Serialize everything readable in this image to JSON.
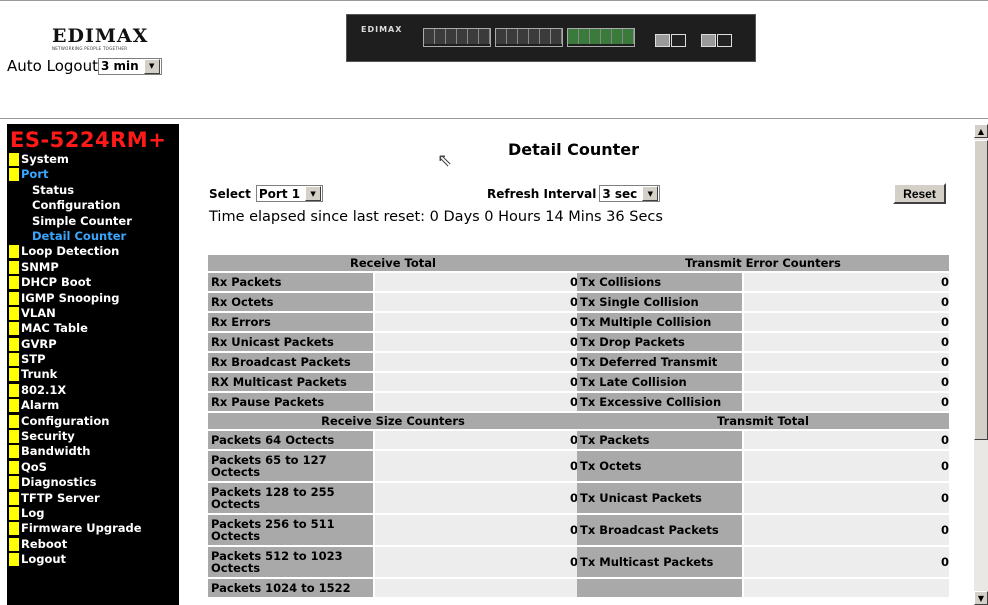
{
  "brand": {
    "logo": "EDIMAX",
    "tagline": "NETWORKING PEOPLE TOGETHER",
    "switch_label": "EDIMAX"
  },
  "auto_logout": {
    "label": "Auto Logout",
    "value": "3 min"
  },
  "product_name": "ES-5224RM+",
  "nav": [
    {
      "label": "System",
      "active": false,
      "sub": false
    },
    {
      "label": "Port",
      "active": true,
      "sub": false
    },
    {
      "label": "Status",
      "active": false,
      "sub": true
    },
    {
      "label": "Configuration",
      "active": false,
      "sub": true
    },
    {
      "label": "Simple Counter",
      "active": false,
      "sub": true
    },
    {
      "label": "Detail Counter",
      "active": true,
      "sub": true
    },
    {
      "label": "Loop Detection",
      "active": false,
      "sub": false
    },
    {
      "label": "SNMP",
      "active": false,
      "sub": false
    },
    {
      "label": "DHCP Boot",
      "active": false,
      "sub": false
    },
    {
      "label": "IGMP Snooping",
      "active": false,
      "sub": false
    },
    {
      "label": "VLAN",
      "active": false,
      "sub": false
    },
    {
      "label": "MAC Table",
      "active": false,
      "sub": false
    },
    {
      "label": "GVRP",
      "active": false,
      "sub": false
    },
    {
      "label": "STP",
      "active": false,
      "sub": false
    },
    {
      "label": "Trunk",
      "active": false,
      "sub": false
    },
    {
      "label": "802.1X",
      "active": false,
      "sub": false
    },
    {
      "label": "Alarm",
      "active": false,
      "sub": false
    },
    {
      "label": "Configuration",
      "active": false,
      "sub": false
    },
    {
      "label": "Security",
      "active": false,
      "sub": false
    },
    {
      "label": "Bandwidth",
      "active": false,
      "sub": false
    },
    {
      "label": "QoS",
      "active": false,
      "sub": false
    },
    {
      "label": "Diagnostics",
      "active": false,
      "sub": false
    },
    {
      "label": "TFTP Server",
      "active": false,
      "sub": false
    },
    {
      "label": "Log",
      "active": false,
      "sub": false
    },
    {
      "label": "Firmware Upgrade",
      "active": false,
      "sub": false
    },
    {
      "label": "Reboot",
      "active": false,
      "sub": false
    },
    {
      "label": "Logout",
      "active": false,
      "sub": false
    }
  ],
  "page_title": "Detail Counter",
  "controls": {
    "select_label": "Select",
    "port_value": "Port 1",
    "refresh_label": "Refresh Interval",
    "refresh_value": "3 sec",
    "reset_label": "Reset",
    "elapsed": "Time elapsed since last reset: 0 Days 0 Hours 14 Mins 36 Secs"
  },
  "tables": {
    "receive_total": {
      "title": "Receive Total",
      "rows": [
        {
          "name": "Rx Packets",
          "value": "0"
        },
        {
          "name": "Rx Octets",
          "value": "0"
        },
        {
          "name": "Rx Errors",
          "value": "0"
        },
        {
          "name": "Rx Unicast Packets",
          "value": "0"
        },
        {
          "name": "Rx Broadcast Packets",
          "value": "0"
        },
        {
          "name": "RX Multicast Packets",
          "value": "0"
        },
        {
          "name": "Rx Pause Packets",
          "value": "0"
        }
      ]
    },
    "transmit_error": {
      "title": "Transmit Error Counters",
      "rows": [
        {
          "name": "Tx Collisions",
          "value": "0"
        },
        {
          "name": "Tx Single Collision",
          "value": "0"
        },
        {
          "name": "Tx Multiple Collision",
          "value": "0"
        },
        {
          "name": "Tx Drop Packets",
          "value": "0"
        },
        {
          "name": "Tx Deferred Transmit",
          "value": "0"
        },
        {
          "name": "Tx Late Collision",
          "value": "0"
        },
        {
          "name": "Tx Excessive Collision",
          "value": "0"
        }
      ]
    },
    "receive_size": {
      "title": "Receive Size Counters",
      "rows": [
        {
          "name": "Packets 64 Octects",
          "value": "0"
        },
        {
          "name": "Packets 65 to 127 Octects",
          "value": "0"
        },
        {
          "name": "Packets 128 to 255 Octects",
          "value": "0"
        },
        {
          "name": "Packets 256 to 511 Octects",
          "value": "0"
        },
        {
          "name": "Packets 512 to 1023 Octects",
          "value": "0"
        },
        {
          "name": "Packets 1024 to 1522",
          "value": ""
        }
      ]
    },
    "transmit_total": {
      "title": "Transmit Total",
      "rows": [
        {
          "name": "Tx Packets",
          "value": "0"
        },
        {
          "name": "Tx Octets",
          "value": "0"
        },
        {
          "name": "Tx Unicast Packets",
          "value": "0"
        },
        {
          "name": "Tx Broadcast Packets",
          "value": "0"
        },
        {
          "name": "Tx Multicast Packets",
          "value": "0"
        },
        {
          "name": "",
          "value": ""
        }
      ]
    }
  }
}
